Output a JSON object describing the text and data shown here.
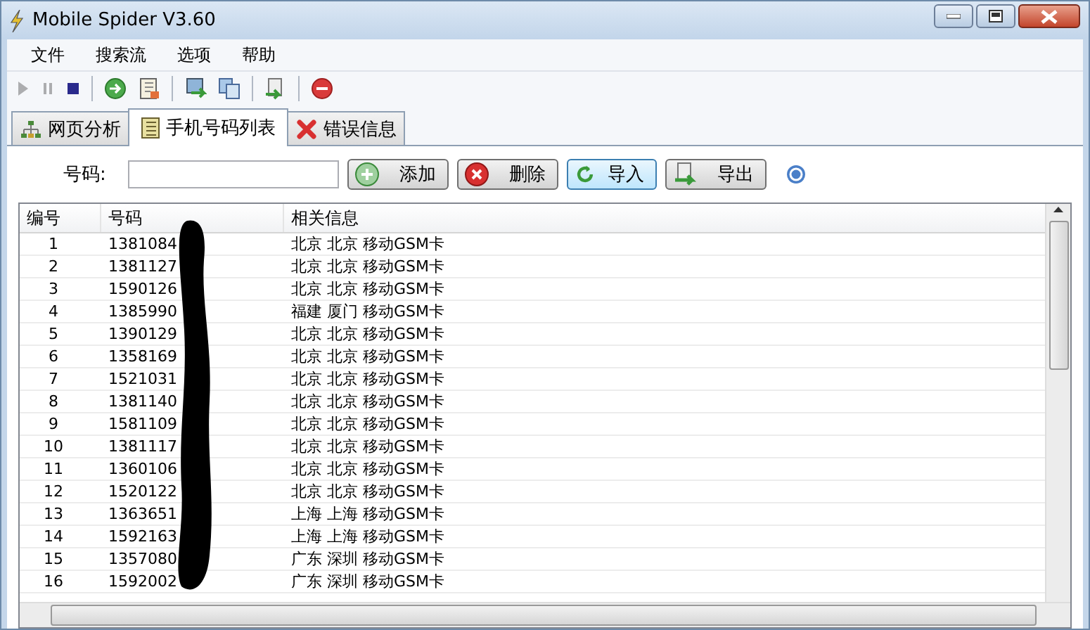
{
  "window": {
    "title": "Mobile Spider V3.60"
  },
  "menu": [
    "文件",
    "搜索流",
    "选项",
    "帮助"
  ],
  "toolbar": [
    {
      "kind": "play",
      "disabled": true
    },
    {
      "kind": "pause",
      "disabled": true
    },
    {
      "kind": "stop",
      "disabled": false
    },
    {
      "kind": "separator"
    },
    {
      "kind": "go",
      "disabled": false
    },
    {
      "kind": "log",
      "disabled": false
    },
    {
      "kind": "separator"
    },
    {
      "kind": "send",
      "disabled": false
    },
    {
      "kind": "copy",
      "disabled": false
    },
    {
      "kind": "separator"
    },
    {
      "kind": "export",
      "disabled": false
    },
    {
      "kind": "separator"
    },
    {
      "kind": "abort",
      "disabled": false
    }
  ],
  "tabs": [
    {
      "label": "网页分析",
      "kind": "tree",
      "selected": false
    },
    {
      "label": "手机号码列表",
      "kind": "list",
      "selected": true
    },
    {
      "label": "错误信息",
      "kind": "error",
      "selected": false
    }
  ],
  "form": {
    "label": "号码:",
    "buttons": [
      {
        "label": "添加",
        "kind": "add",
        "focused": false
      },
      {
        "label": "删除",
        "kind": "delete",
        "focused": false
      },
      {
        "label": "导入",
        "kind": "import",
        "focused": true
      },
      {
        "label": "导出",
        "kind": "export",
        "focused": false
      }
    ]
  },
  "table": {
    "columns": [
      "编号",
      "号码",
      "相关信息"
    ],
    "rows": [
      [
        "1",
        "1381084",
        "北京 北京 移动GSM卡"
      ],
      [
        "2",
        "1381127",
        "北京 北京 移动GSM卡"
      ],
      [
        "3",
        "1590126",
        "北京 北京 移动GSM卡"
      ],
      [
        "4",
        "1385990",
        "福建 厦门 移动GSM卡"
      ],
      [
        "5",
        "1390129",
        "北京 北京 移动GSM卡"
      ],
      [
        "6",
        "1358169",
        "北京 北京 移动GSM卡"
      ],
      [
        "7",
        "1521031",
        "北京 北京 移动GSM卡"
      ],
      [
        "8",
        "1381140",
        "北京 北京 移动GSM卡"
      ],
      [
        "9",
        "1581109",
        "北京 北京 移动GSM卡"
      ],
      [
        "10",
        "1381117",
        "北京 北京 移动GSM卡"
      ],
      [
        "11",
        "1360106",
        "北京 北京 移动GSM卡"
      ],
      [
        "12",
        "1520122",
        "北京 北京 移动GSM卡"
      ],
      [
        "13",
        "1363651",
        "上海 上海 移动GSM卡"
      ],
      [
        "14",
        "1592163",
        "上海 上海 移动GSM卡"
      ],
      [
        "15",
        "1357080",
        "广东 深圳 移动GSM卡"
      ],
      [
        "16",
        "1592002",
        "广东 深圳 移动GSM卡"
      ]
    ]
  }
}
